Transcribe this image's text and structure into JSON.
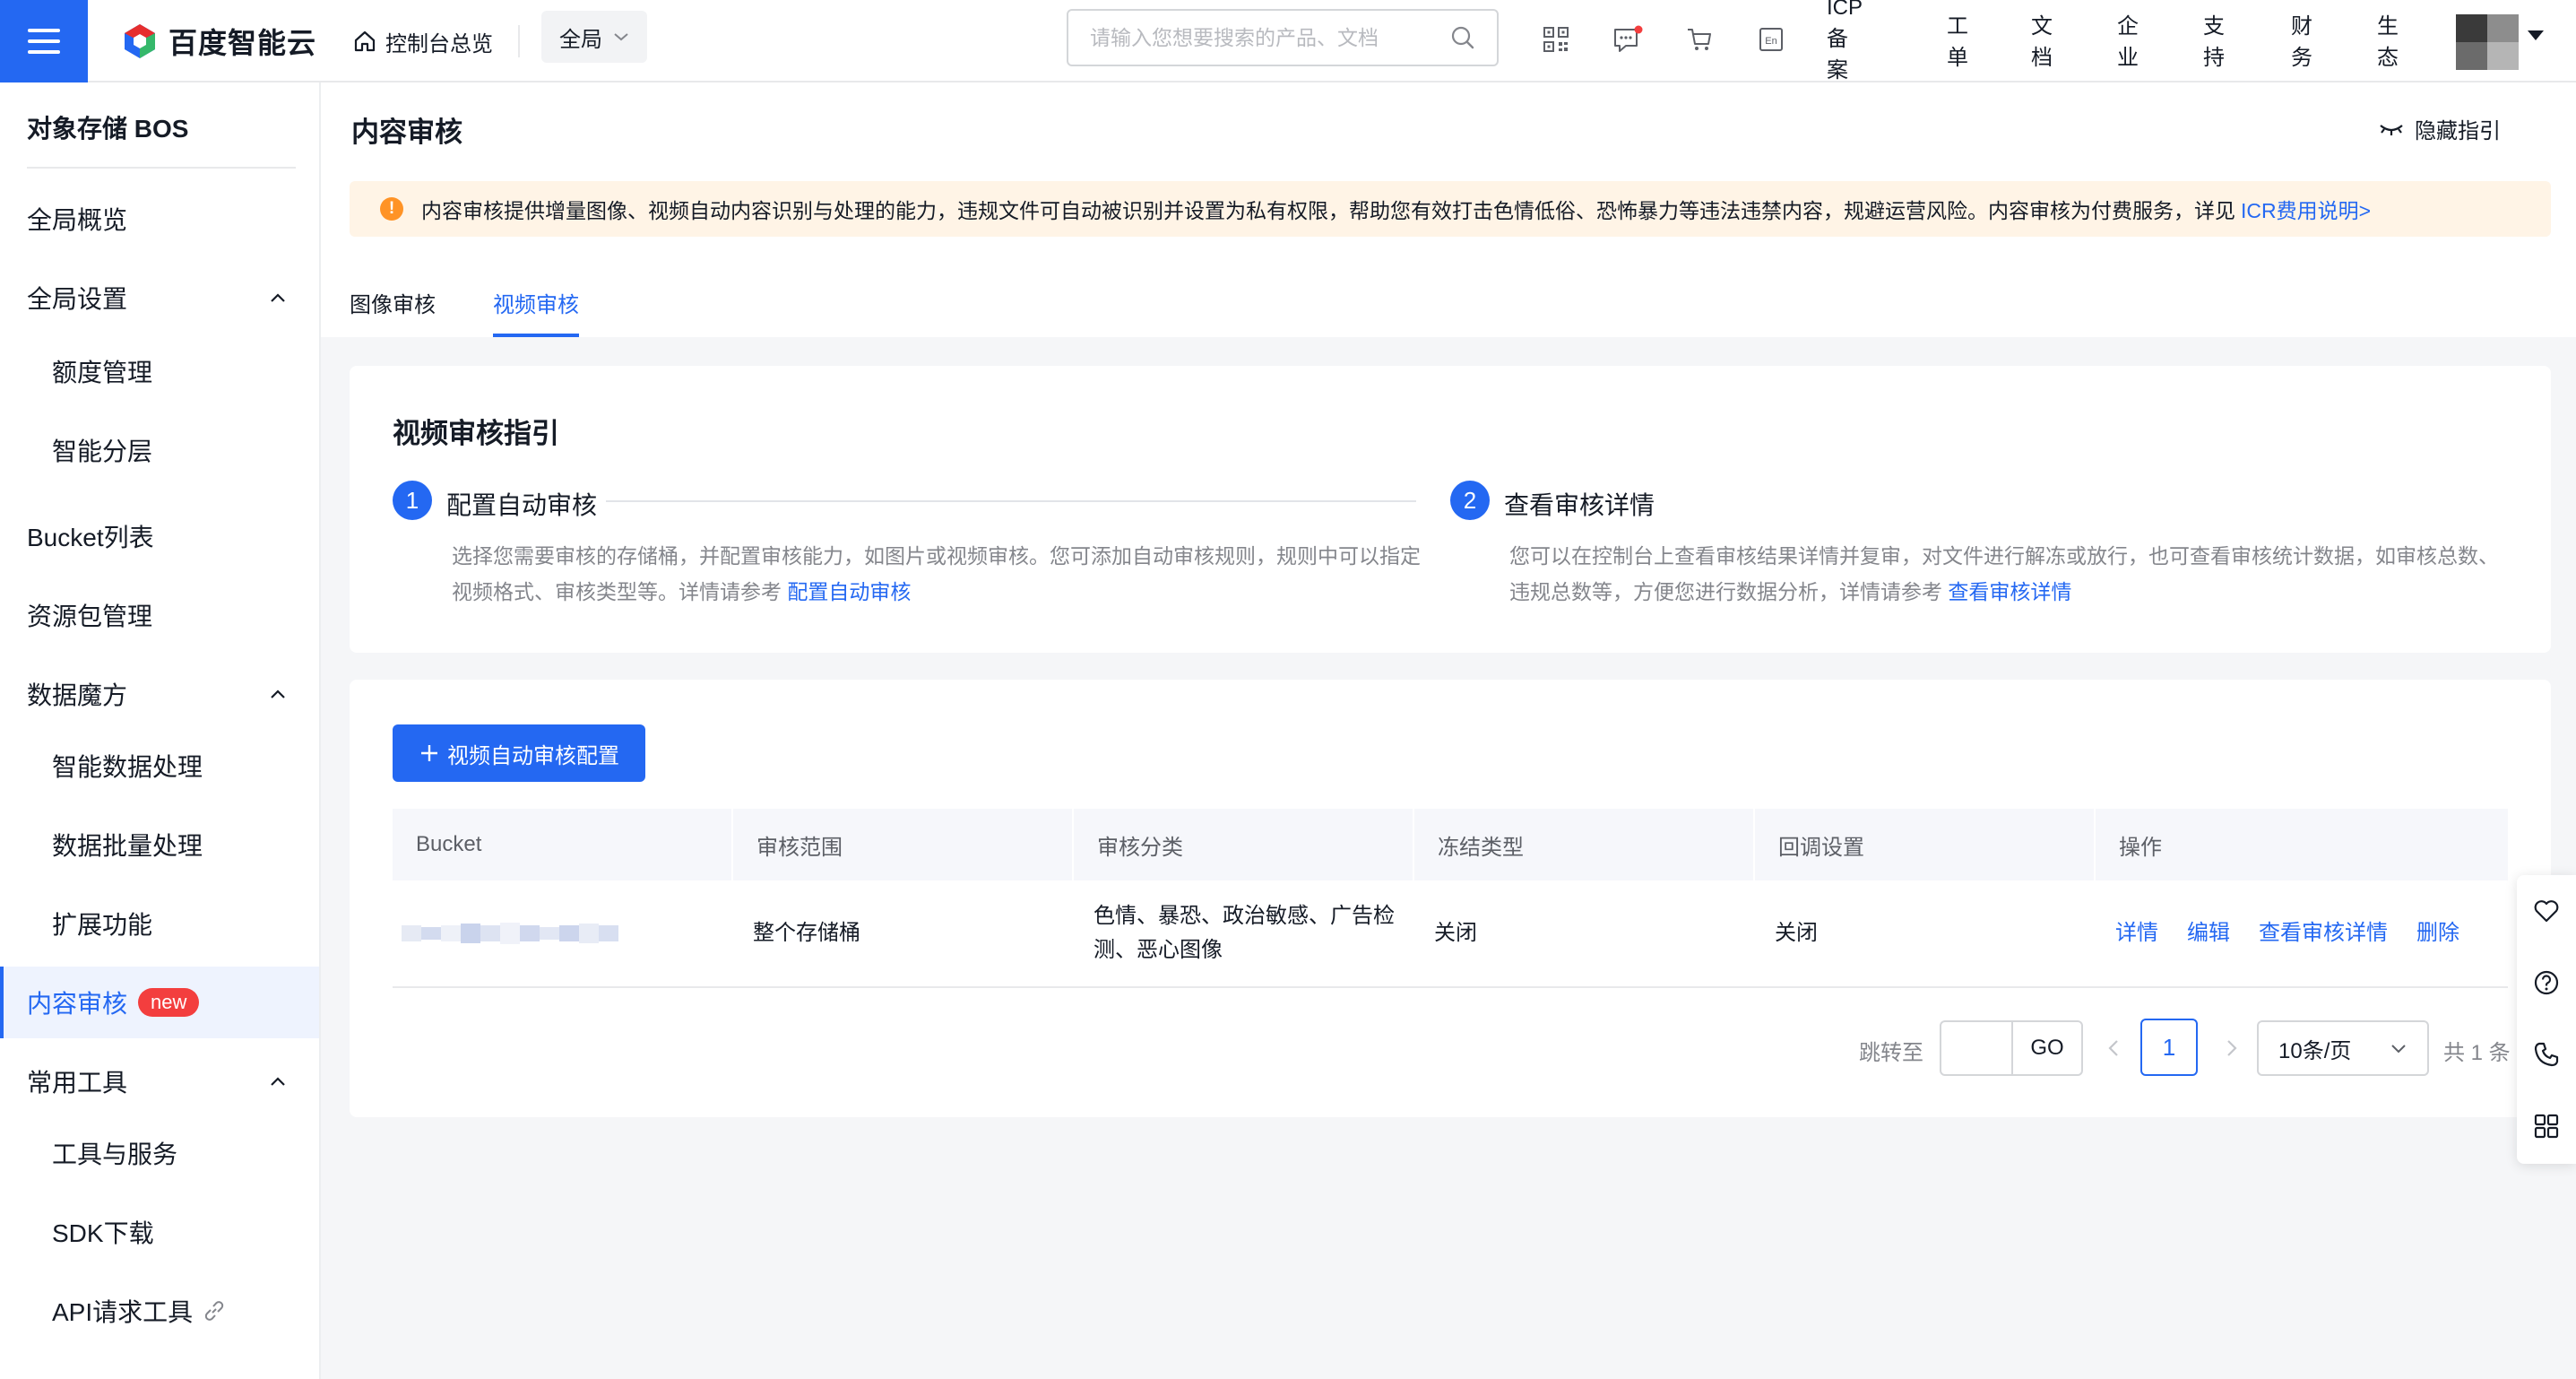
{
  "topbar": {
    "logo_text": "百度智能云",
    "home_label": "控制台总览",
    "region_label": "全局",
    "search_placeholder": "请输入您想要搜索的产品、文档",
    "nav_links": [
      "ICP备案",
      "工单",
      "文档",
      "企业",
      "支持",
      "财务",
      "生态"
    ],
    "icons": [
      "qrcode-icon",
      "message-icon",
      "cart-icon",
      "language-icon"
    ],
    "icon_language_text": "En"
  },
  "sidebar": {
    "title": "对象存储 BOS",
    "items": [
      {
        "label": "全局概览",
        "level": 1
      },
      {
        "label": "全局设置",
        "level": 1,
        "expanded": true
      },
      {
        "label": "额度管理",
        "level": 2
      },
      {
        "label": "智能分层",
        "level": 2
      },
      {
        "label": "Bucket列表",
        "level": 1
      },
      {
        "label": "资源包管理",
        "level": 1
      },
      {
        "label": "数据魔方",
        "level": 1,
        "expanded": true
      },
      {
        "label": "智能数据处理",
        "level": 2
      },
      {
        "label": "数据批量处理",
        "level": 2
      },
      {
        "label": "扩展功能",
        "level": 2
      },
      {
        "label": "内容审核",
        "level": 1,
        "active": true,
        "badge": "new"
      },
      {
        "label": "常用工具",
        "level": 1,
        "expanded": true
      },
      {
        "label": "工具与服务",
        "level": 2
      },
      {
        "label": "SDK下载",
        "level": 2
      },
      {
        "label": "API请求工具",
        "level": 2
      }
    ]
  },
  "page": {
    "title": "内容审核",
    "hide_guide_label": "隐藏指引",
    "notice_text": "内容审核提供增量图像、视频自动内容识别与处理的能力，违规文件可自动被识别并设置为私有权限，帮助您有效打击色情低俗、恐怖暴力等违法违禁内容，规避运营风险。内容审核为付费服务，详见",
    "notice_link": "ICR费用说明>",
    "tabs": [
      {
        "label": "图像审核",
        "active": false
      },
      {
        "label": "视频审核",
        "active": true
      }
    ]
  },
  "guide": {
    "title": "视频审核指引",
    "steps": [
      {
        "num": "1",
        "title": "配置自动审核",
        "desc": "选择您需要审核的存储桶，并配置审核能力，如图片或视频审核。您可添加自动审核规则，规则中可以指定视频格式、审核类型等。详情请参考",
        "link": "配置自动审核"
      },
      {
        "num": "2",
        "title": "查看审核详情",
        "desc": "您可以在控制台上查看审核结果详情并复审，对文件进行解冻或放行，也可查看审核统计数据，如审核总数、违规总数等，方便您进行数据分析，详情请参考",
        "link": "查看审核详情"
      }
    ]
  },
  "table": {
    "add_button": "视频自动审核配置",
    "columns": [
      "Bucket",
      "审核范围",
      "审核分类",
      "冻结类型",
      "回调设置",
      "操作"
    ],
    "rows": [
      {
        "bucket": "",
        "scope": "整个存储桶",
        "category": "色情、暴恐、政治敏感、广告检测、恶心图像",
        "freeze": "关闭",
        "callback": "关闭",
        "actions": [
          "详情",
          "编辑",
          "查看审核详情",
          "删除"
        ]
      }
    ]
  },
  "pagination": {
    "jump_label": "跳转至",
    "go_label": "GO",
    "current_page": "1",
    "page_size": "10条/页",
    "total": "共 1 条"
  },
  "colors": {
    "primary": "#2468f2",
    "danger": "#f33e3e",
    "warning": "#ff9326",
    "notice_bg": "#fff4e6"
  }
}
